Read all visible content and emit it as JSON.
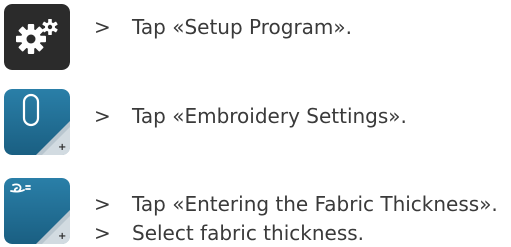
{
  "instructions": [
    {
      "marker": ">",
      "text": "Tap «Setup Program»."
    },
    {
      "marker": ">",
      "text": "Tap «Embroidery Settings»."
    },
    {
      "marker": ">",
      "text": "Tap «Entering the Fabric Thickness»."
    },
    {
      "marker": ">",
      "text": "Select fabric thickness."
    }
  ],
  "icons": {
    "setup": {
      "name": "setup-program-icon",
      "background": "#2b2b2b"
    },
    "embroidery": {
      "name": "embroidery-settings-icon",
      "background": "#1e6e95"
    },
    "fabric": {
      "name": "fabric-thickness-icon",
      "background": "#1e6e95"
    }
  }
}
